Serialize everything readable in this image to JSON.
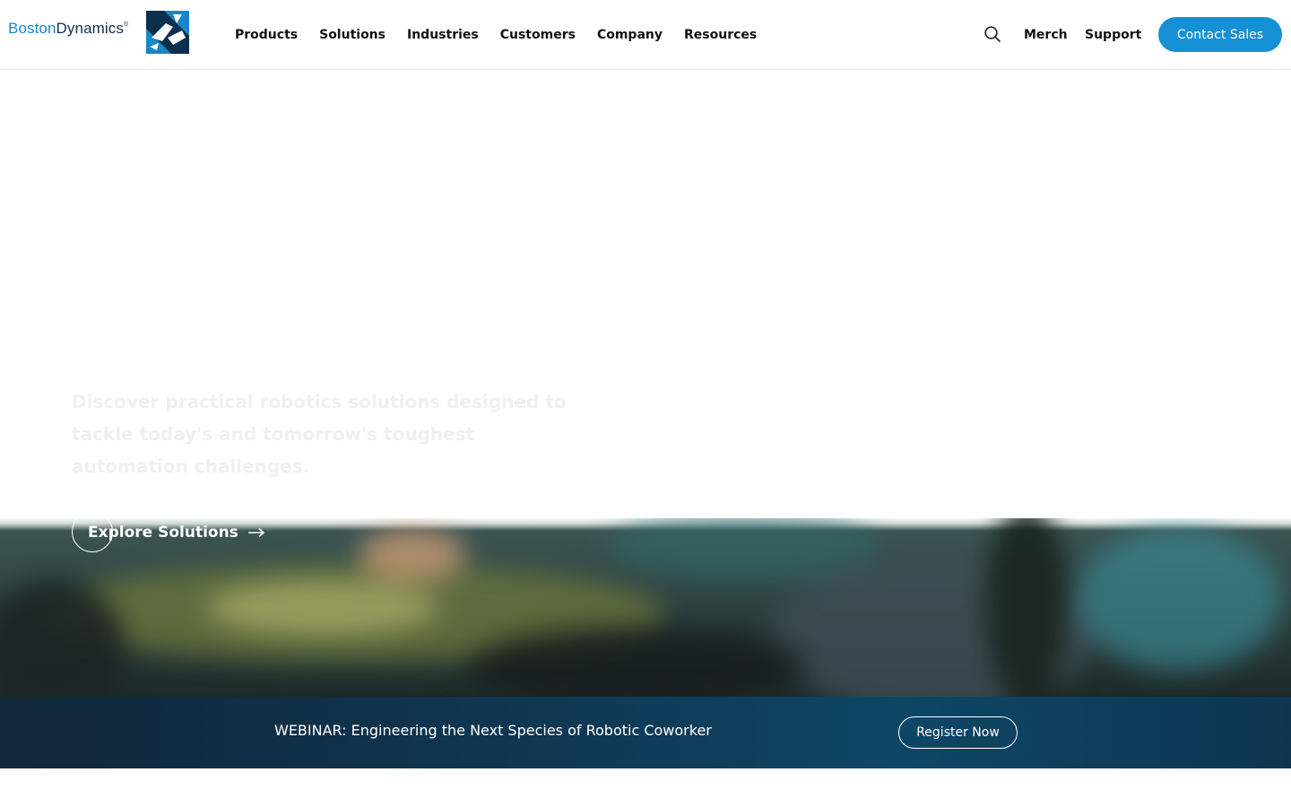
{
  "header": {
    "logo": {
      "word1": "Boston",
      "word2": "Dynamics",
      "mark": "®"
    },
    "nav": [
      {
        "label": "Products"
      },
      {
        "label": "Solutions"
      },
      {
        "label": "Industries"
      },
      {
        "label": "Customers"
      },
      {
        "label": "Company"
      },
      {
        "label": "Resources"
      }
    ],
    "search_icon": "search-icon",
    "merch_label": "Merch",
    "support_label": "Support",
    "contact_label": "Contact Sales"
  },
  "hero": {
    "description": "Discover practical robotics solutions designed to tackle today's and tomorrow's toughest automation challenges.",
    "cta_label": "Explore Solutions",
    "cta_icon": "arrow-right-icon"
  },
  "banner": {
    "text": "WEBINAR: Engineering the Next Species of Robotic Coworker",
    "button_label": "Register Now"
  },
  "colors": {
    "brand_blue": "#1590d5",
    "logo_dark": "#0d2f4d",
    "banner_dark": "#10263a"
  }
}
